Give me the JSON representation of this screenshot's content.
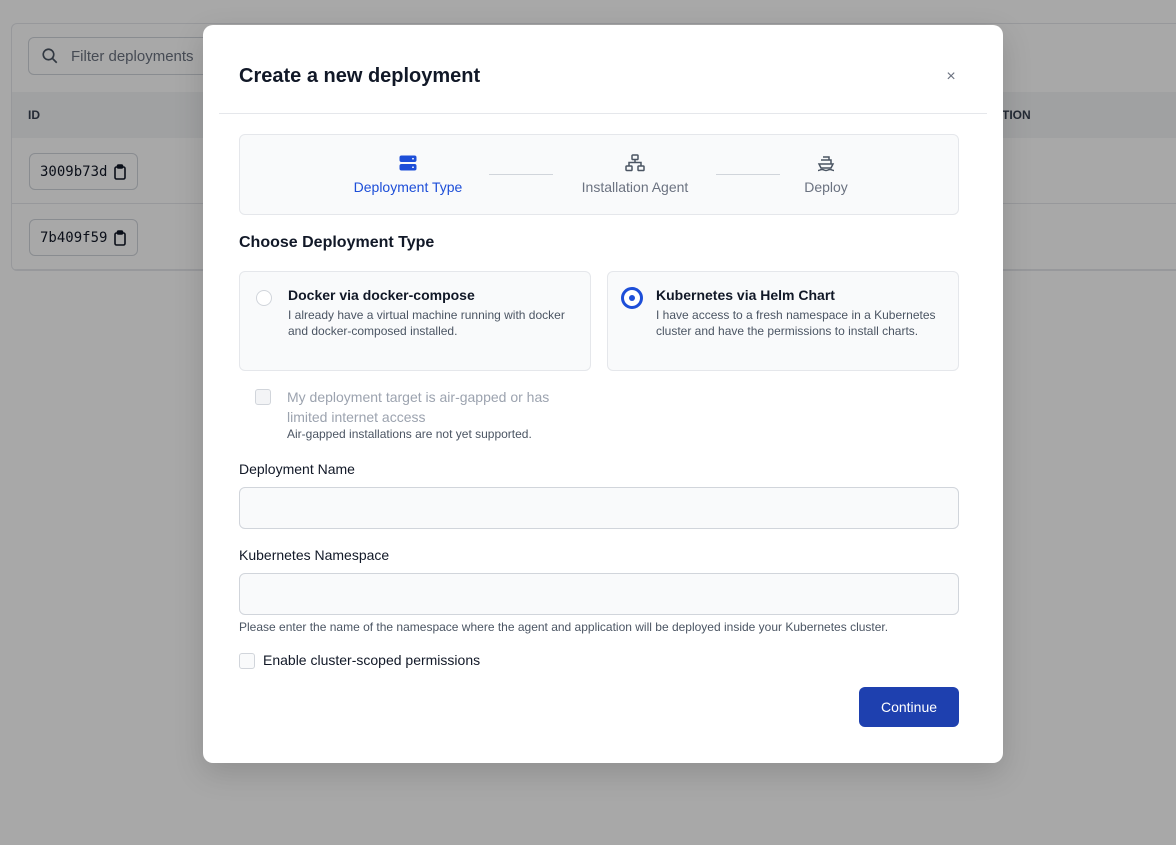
{
  "background": {
    "search": {
      "placeholder": "Filter deployments"
    },
    "table": {
      "columns": {
        "id": "ID",
        "action_partial": "TION"
      },
      "rows": [
        {
          "id": "3009b73d"
        },
        {
          "id": "7b409f59"
        }
      ]
    }
  },
  "modal": {
    "title": "Create a new deployment",
    "close_label": "×",
    "steps": [
      {
        "label": "Deployment Type",
        "icon": "server-stack-icon",
        "state": "active"
      },
      {
        "label": "Installation Agent",
        "icon": "network-icon",
        "state": "pending"
      },
      {
        "label": "Deploy",
        "icon": "ship-icon",
        "state": "pending"
      }
    ],
    "section_title": "Choose Deployment Type",
    "options": [
      {
        "title": "Docker via docker-compose",
        "description": "I already have a virtual machine running with docker and docker-composed installed.",
        "selected": false
      },
      {
        "title": "Kubernetes via Helm Chart",
        "description": "I have access to a fresh namespace in a Kubernetes cluster and have the permissions to install charts.",
        "selected": true
      }
    ],
    "airgap": {
      "label": "My deployment target is air-gapped or has limited internet access",
      "note": "Air-gapped installations are not yet supported.",
      "checked": false,
      "disabled": true
    },
    "deployment_name": {
      "label": "Deployment Name",
      "value": ""
    },
    "namespace": {
      "label": "Kubernetes Namespace",
      "value": "",
      "help": "Please enter the name of the namespace where the agent and application will be deployed inside your Kubernetes cluster."
    },
    "cluster_scope": {
      "label": "Enable cluster-scoped permissions",
      "checked": false
    },
    "continue_label": "Continue"
  },
  "colors": {
    "accent": "#1d4ed8",
    "button": "#1e40af",
    "overlay": "rgba(0,0,0,0.34)"
  }
}
